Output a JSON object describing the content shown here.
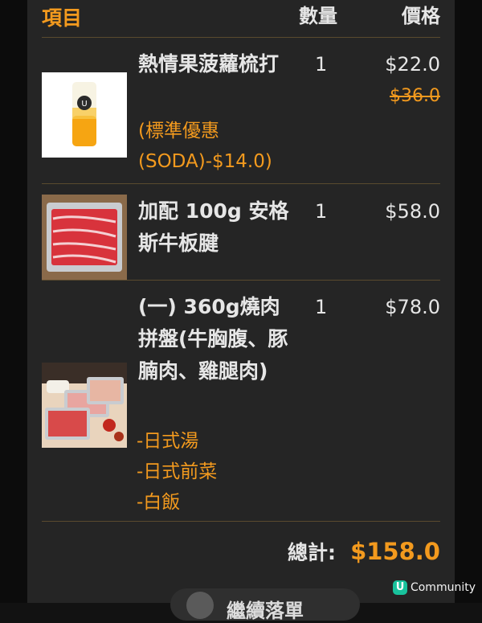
{
  "header": {
    "item": "項目",
    "qty": "數量",
    "price": "價格"
  },
  "items": [
    {
      "name": "熱情果菠蘿梳打",
      "qty": "1",
      "price": "$22.0",
      "original_price": "$36.0",
      "note": "(標準優惠(SODA)-$14.0)",
      "options": []
    },
    {
      "name": "加配 100g 安格斯牛板腱",
      "qty": "1",
      "price": "$58.0",
      "options": []
    },
    {
      "name": "(一) 360g燒肉拼盤(牛胸腹、豚腩肉、雞腿肉)",
      "qty": "1",
      "price": "$78.0",
      "options": [
        "-日式湯",
        "-日式前菜",
        "-白飯"
      ]
    }
  ],
  "total": {
    "label": "總計:",
    "value": "$158.0"
  },
  "continue_button": {
    "label": "繼續落單"
  },
  "watermark": {
    "badge": "U",
    "text": "Community"
  }
}
